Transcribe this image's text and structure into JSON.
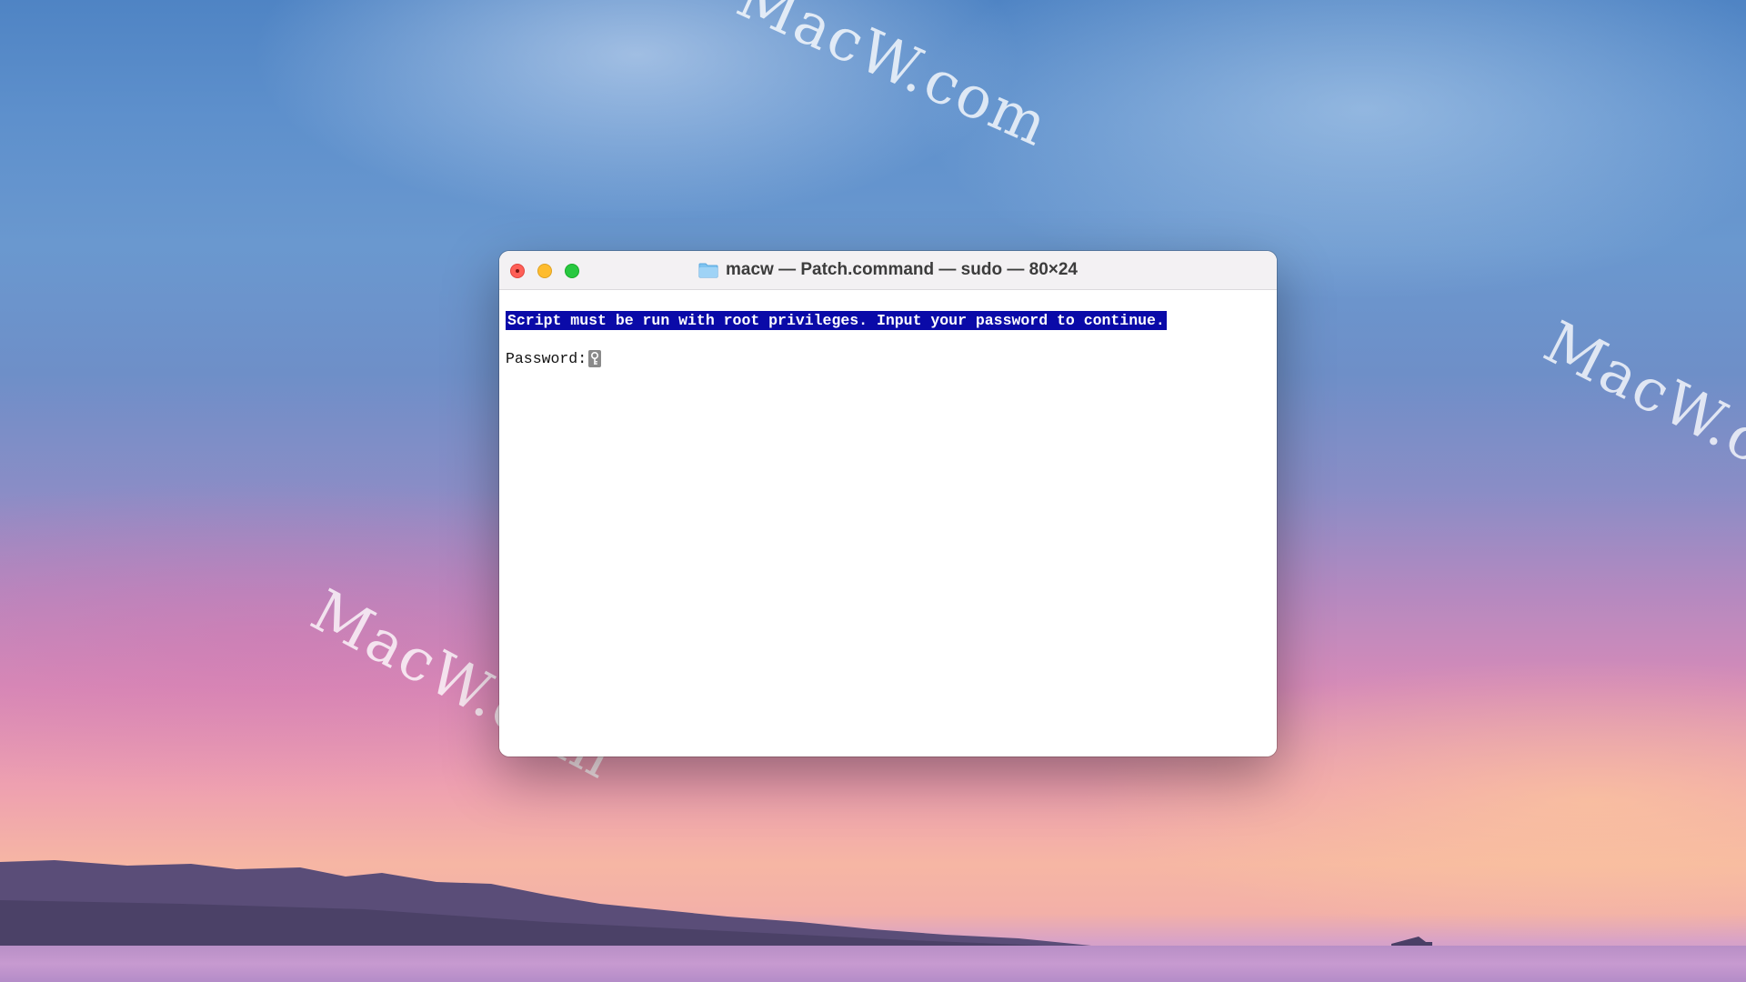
{
  "desktop": {
    "watermarks": [
      "MacW.com",
      "MacW.com",
      "MacW.com"
    ]
  },
  "window": {
    "title": "macw — Patch.command — sudo — 80×24",
    "title_icon": "folder-icon",
    "buttons": {
      "close": "close-button",
      "minimize": "minimize-button",
      "zoom": "zoom-button"
    }
  },
  "terminal": {
    "line1": "Script must be run with root privileges. Input your password to continue.",
    "prompt": "Password:",
    "cursor_icon": "key-icon",
    "highlight_color": "#0a0aa8"
  }
}
